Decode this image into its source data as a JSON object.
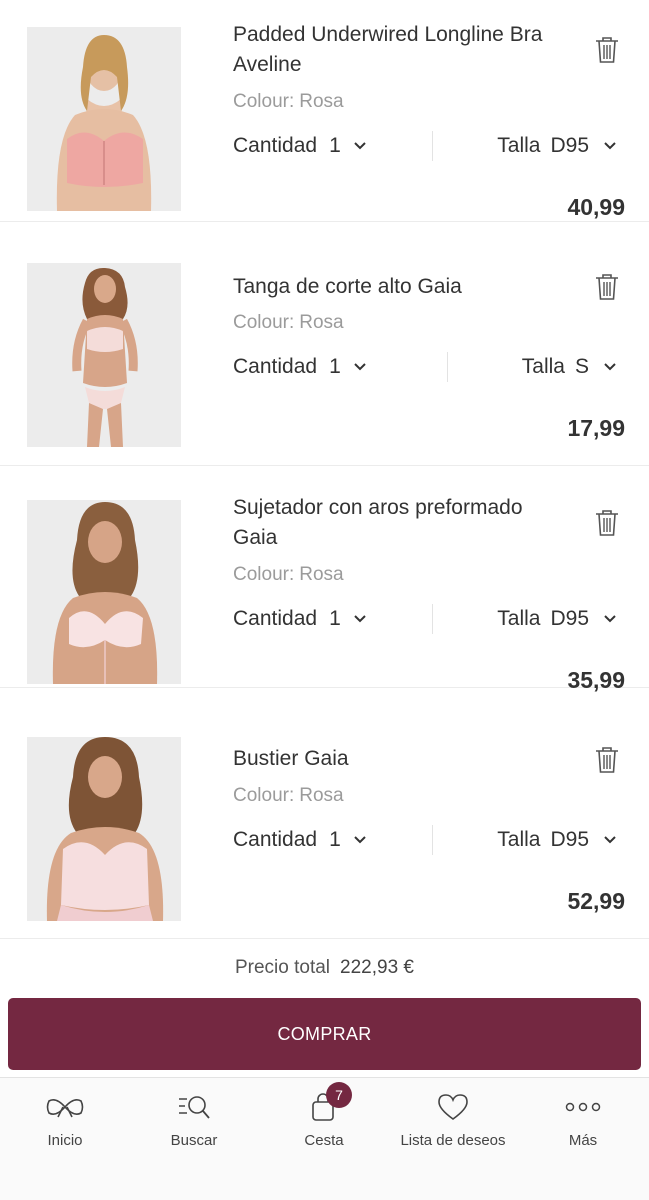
{
  "cart": {
    "colour_label": "Colour:",
    "quantity_label": "Cantidad",
    "size_label": "Talla",
    "items": [
      {
        "title": "Padded Underwired Longline Bra Aveline",
        "colour": "Rosa",
        "quantity": "1",
        "size": "D95",
        "price": "40,99",
        "image": "product-photo-aveline"
      },
      {
        "title": "Tanga de corte alto Gaia",
        "colour": "Rosa",
        "quantity": "1",
        "size": "S",
        "price": "17,99",
        "image": "product-photo-gaia-thong"
      },
      {
        "title": "Sujetador con aros preformado Gaia",
        "colour": "Rosa",
        "quantity": "1",
        "size": "D95",
        "price": "35,99",
        "image": "product-photo-gaia-bra"
      },
      {
        "title": "Bustier Gaia",
        "colour": "Rosa",
        "quantity": "1",
        "size": "D95",
        "price": "52,99",
        "image": "product-photo-gaia-bustier"
      }
    ]
  },
  "summary": {
    "total_label": "Precio total",
    "total_value": "222,93 €"
  },
  "checkout": {
    "button_label": "COMPRAR"
  },
  "tabbar": {
    "items": [
      {
        "label": "Inicio",
        "icon": "bow-icon"
      },
      {
        "label": "Buscar",
        "icon": "search-icon"
      },
      {
        "label": "Cesta",
        "icon": "bag-icon",
        "badge": "7"
      },
      {
        "label": "Lista de deseos",
        "icon": "heart-icon"
      },
      {
        "label": "Más",
        "icon": "more-icon"
      }
    ]
  },
  "colors": {
    "accent": "#742841",
    "tile_background": "#ececec"
  }
}
